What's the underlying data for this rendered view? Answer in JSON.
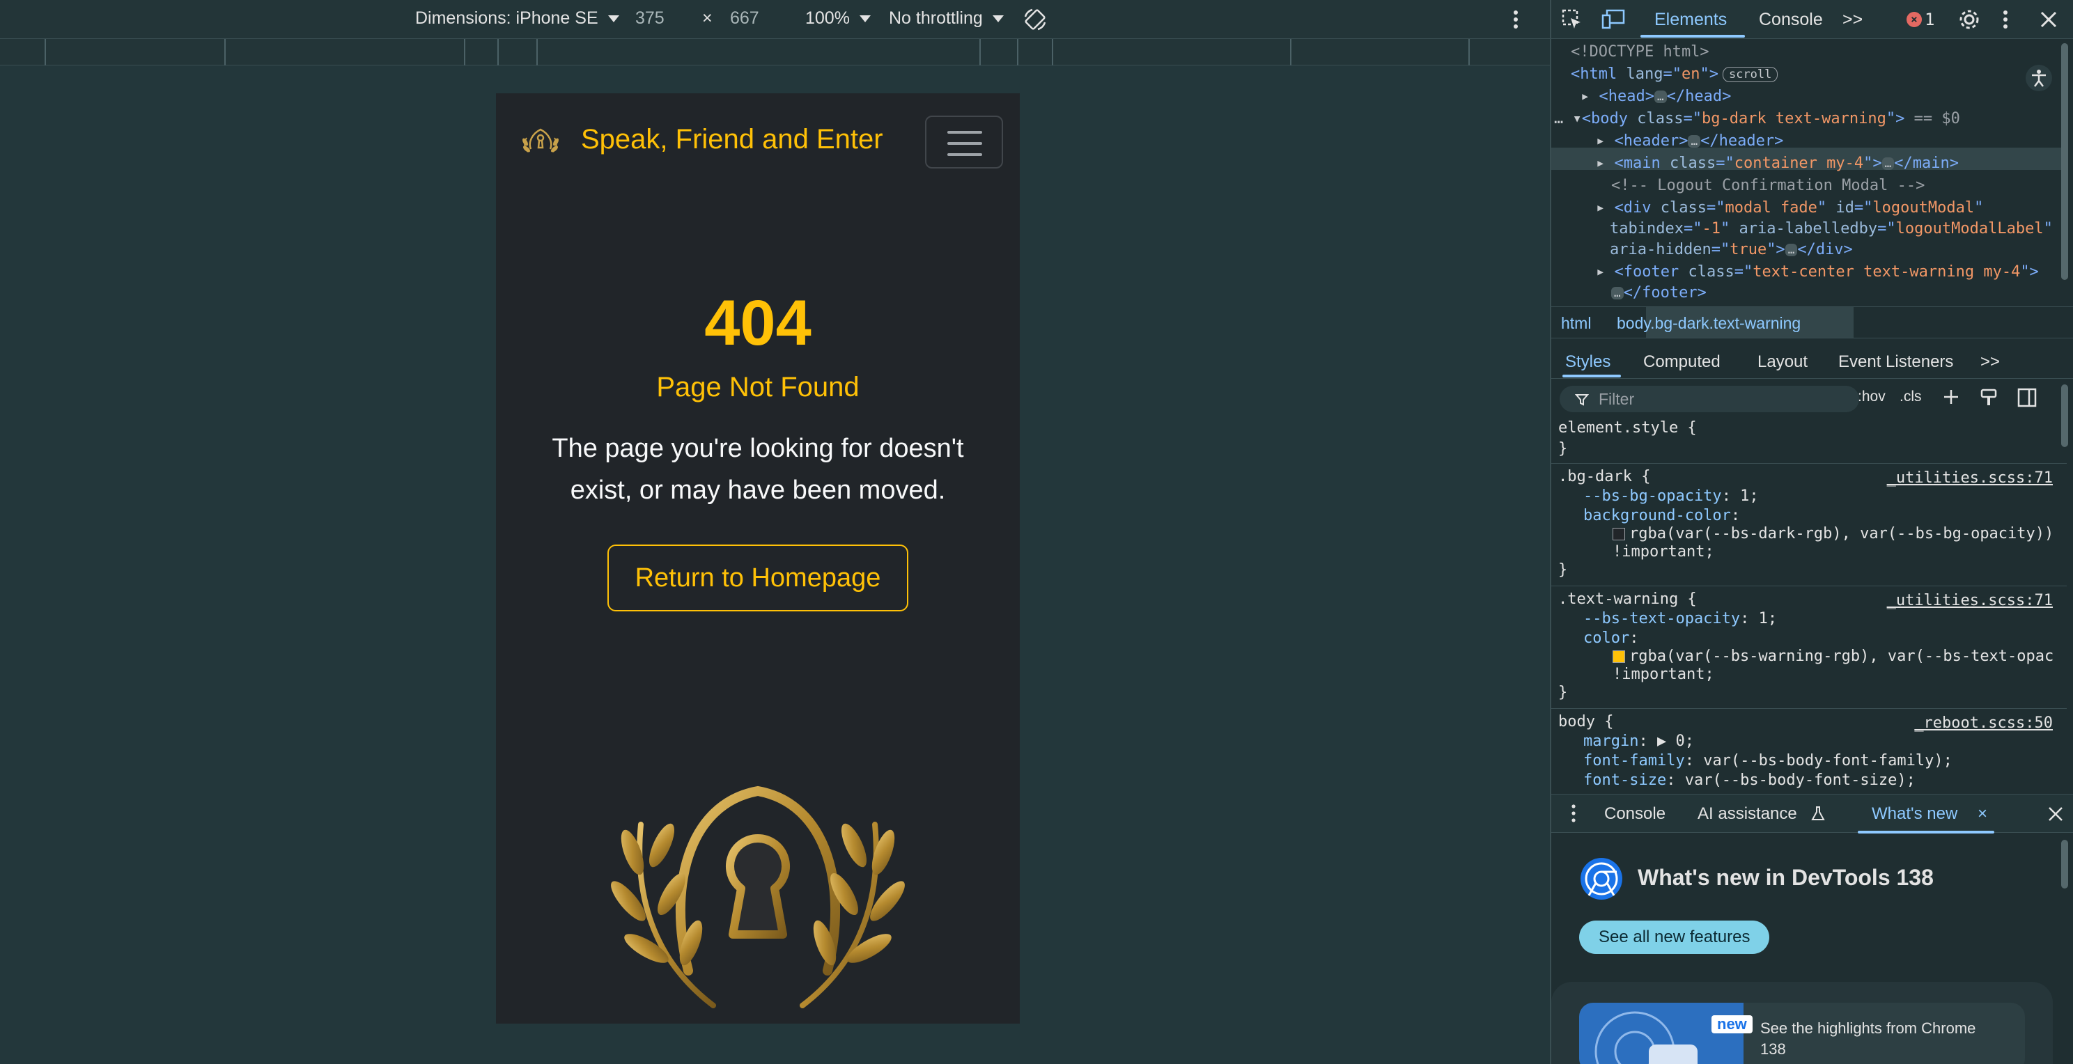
{
  "device_toolbar": {
    "dimensions_label": "Dimensions: iPhone SE",
    "width": "375",
    "times": "×",
    "height": "667",
    "zoom": "100%",
    "throttling": "No throttling"
  },
  "site": {
    "brand": "Speak, Friend and Enter",
    "code": "404",
    "title": "Page Not Found",
    "message": "The page you're looking for doesn't exist, or may have been moved.",
    "button": "Return to Homepage",
    "accent": "#ffc107",
    "background": "#212529"
  },
  "devtools": {
    "tabs": {
      "elements": "Elements",
      "console": "Console",
      "more": ">>"
    },
    "error_count": "1",
    "dom": {
      "doctype": "<!DOCTYPE html>",
      "html_open": "<html",
      "html_attr": " lang",
      "html_eq": "=\"",
      "html_val": "en",
      "html_close": "\">",
      "scroll_chip": "scroll",
      "head_open": "<head>",
      "head_close": "</head>",
      "body_open": "<body",
      "body_attr": " class",
      "body_val": "bg-dark text-warning",
      "body_end": "\">",
      "body_suffix": " == $0",
      "header_open": "<header>",
      "header_close": "</header>",
      "main_open": "<main",
      "main_attr": " class",
      "main_val": "container my-4",
      "main_close": "</main>",
      "comment": "<!-- Logout Confirmation Modal -->",
      "div_open": "<div",
      "div_attr_class": " class",
      "div_val_class": "modal fade",
      "div_attr_id": " id",
      "div_val_id": "logoutModal",
      "div_attr_tab": "tabindex",
      "div_val_tab": "-1",
      "div_attr_aria": " aria-labelledby",
      "div_val_aria": "logoutModalLabel",
      "div_attr_hidden": "aria-hidden",
      "div_val_hidden": "true",
      "div_close": "</div>",
      "footer_open": "<footer",
      "footer_attr": " class",
      "footer_val": "text-center text-warning my-4",
      "footer_close": "</footer>"
    },
    "breadcrumbs": [
      "html",
      "body.bg-dark.text-warning"
    ],
    "subtabs": [
      "Styles",
      "Computed",
      "Layout",
      "Event Listeners",
      ">>"
    ],
    "filter": {
      "placeholder": "Filter",
      "hov": ":hov",
      "cls": ".cls"
    },
    "styles": {
      "element_style": "element.style {",
      "close": "}",
      "bg_dark": {
        "selector": ".bg-dark {",
        "source": "_utilities.scss:71",
        "p1_name": "--bs-bg-opacity",
        "p1_val": ": 1;",
        "p2_name": "background-color",
        "p2_val": ":",
        "p2_fn": "rgba(var(--bs-dark-rgb), var(--bs-bg-opacity))",
        "important": "!important;"
      },
      "text_warning": {
        "selector": ".text-warning {",
        "source": "_utilities.scss:71",
        "p1_name": "--bs-text-opacity",
        "p1_val": ": 1;",
        "p2_name": "color",
        "p2_val": ":",
        "p2_fn": "rgba(var(--bs-warning-rgb), var(--bs-text-opac",
        "important": "!important;"
      },
      "body": {
        "selector": "body {",
        "source": "_reboot.scss:50",
        "p1_name": "margin",
        "p1_val": ": ▶ 0;",
        "p2_name": "font-family",
        "p2_val": ": var(--bs-body-font-family);",
        "p3_name": "font-size",
        "p3_val": ": var(--bs-body-font-size);"
      }
    },
    "drawer": {
      "console": "Console",
      "ai": "AI assistance",
      "whatsnew": "What's new",
      "close": "×"
    },
    "whatsnew": {
      "title": "What's new in DevTools 138",
      "button": "See all new features",
      "badge": "new",
      "card_text": "See the highlights from Chrome 138"
    }
  }
}
